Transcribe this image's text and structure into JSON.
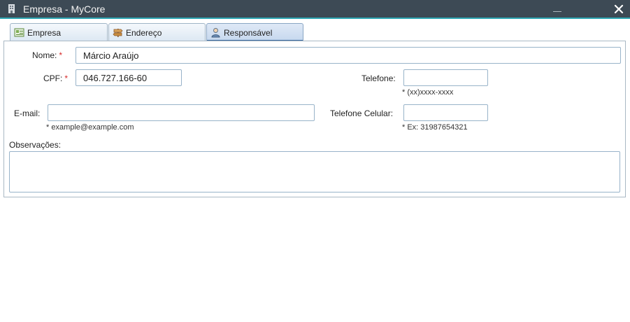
{
  "window": {
    "title": "Empresa - MyCore",
    "icon": "building-icon",
    "accent": "#2ea6b3",
    "titlebar_bg": "#3d4a55"
  },
  "tabs": [
    {
      "label": "Empresa",
      "icon": "company-card-icon",
      "active": false
    },
    {
      "label": "Endereço",
      "icon": "signpost-icon",
      "active": false
    },
    {
      "label": "Responsável",
      "icon": "person-icon",
      "active": true
    }
  ],
  "form": {
    "nome": {
      "label": "Nome:",
      "required_mark": "*",
      "value": "Márcio Araújo"
    },
    "cpf": {
      "label": "CPF:",
      "required_mark": "*",
      "value": "046.727.166-60"
    },
    "telefone": {
      "label": "Telefone:",
      "value": "",
      "hint": "* (xx)xxxx-xxxx"
    },
    "email": {
      "label": "E-mail:",
      "value": "",
      "hint": "* example@example.com"
    },
    "telefone_celular": {
      "label": "Telefone Celular:",
      "value": "",
      "hint": "* Ex: 31987654321"
    },
    "observacoes": {
      "label": "Observações:",
      "value": ""
    }
  }
}
